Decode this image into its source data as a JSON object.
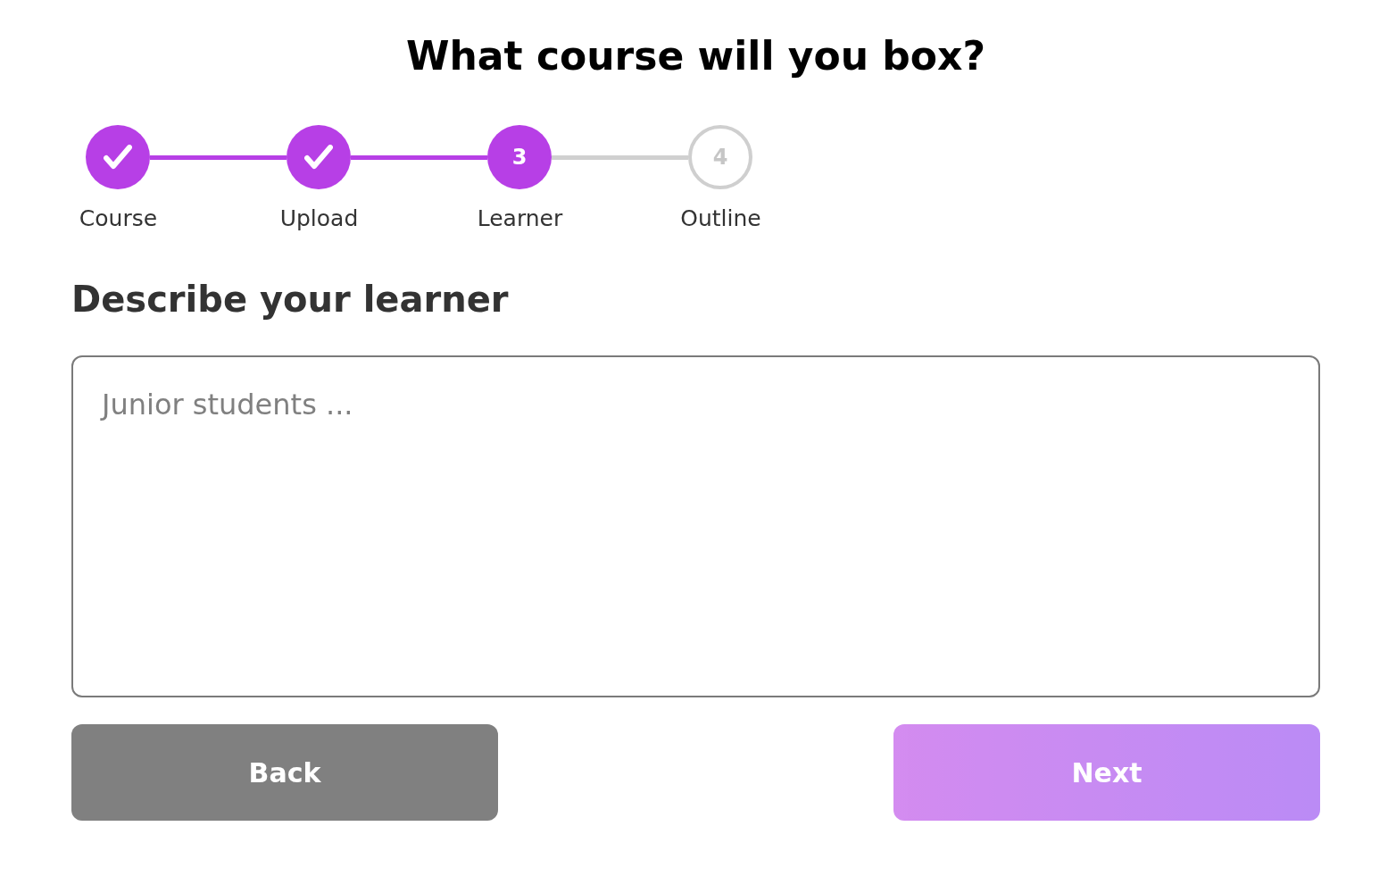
{
  "title": "What course will you box?",
  "steps": [
    {
      "label": "Course",
      "kind": "done"
    },
    {
      "label": "Upload",
      "kind": "done"
    },
    {
      "label": "Learner",
      "kind": "current",
      "number": "3"
    },
    {
      "label": "Outline",
      "kind": "todo",
      "number": "4"
    }
  ],
  "heading": "Describe your learner",
  "learner_field": {
    "placeholder": "Junior students ..."
  },
  "buttons": [
    {
      "label": "Back",
      "kind": "back",
      "disabled": false
    },
    {
      "label": "Next",
      "kind": "next",
      "disabled": true
    }
  ]
}
